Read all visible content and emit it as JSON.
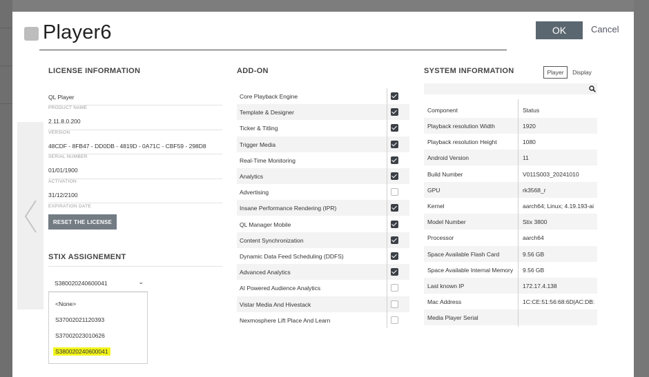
{
  "window": {
    "title": "Player6"
  },
  "header": {
    "ok_label": "OK",
    "cancel_label": "Cancel"
  },
  "license": {
    "title": "LICENSE INFORMATION",
    "fields": [
      {
        "value": "QL Player",
        "label": "PRODUCT NAME"
      },
      {
        "value": "2.11.8.0.200",
        "label": "VERSION"
      },
      {
        "value": "48CDF - 8FB47 - DD0DB - 4819D - 0A71C - CBF59 - 298D8",
        "label": "SERIAL NUMBER"
      },
      {
        "value": "01/01/1900",
        "label": "ACTIVATION"
      },
      {
        "value": "31/12/2100",
        "label": "EXPIRATION DATE"
      }
    ],
    "reset_label": "RESET THE LICENSE"
  },
  "stix": {
    "title": "STIX ASSIGNEMENT",
    "selected": "S380020240600041",
    "options": [
      "<None>",
      "S37002021120393",
      "S37002023010626",
      "S380020240600041"
    ],
    "highlighted_index": 3
  },
  "addon": {
    "title": "ADD-ON",
    "items": [
      {
        "label": "Core Playback Engine",
        "checked": true
      },
      {
        "label": "Template & Designer",
        "checked": true
      },
      {
        "label": "Ticker & Titling",
        "checked": true
      },
      {
        "label": "Trigger Media",
        "checked": true
      },
      {
        "label": "Real-Time Monitoring",
        "checked": true
      },
      {
        "label": "Analytics",
        "checked": true
      },
      {
        "label": "Advertising",
        "checked": false
      },
      {
        "label": "Insane Performance Rendering (IPR)",
        "checked": true
      },
      {
        "label": "QL Manager Mobile",
        "checked": true
      },
      {
        "label": "Content Synchronization",
        "checked": true
      },
      {
        "label": "Dynamic Data Feed Scheduling (DDFS)",
        "checked": true
      },
      {
        "label": "Advanced Analytics",
        "checked": true
      },
      {
        "label": "AI Powered Audience Analytics",
        "checked": false
      },
      {
        "label": "Vistar Media And Hivestack",
        "checked": false
      },
      {
        "label": "Nexmosphere Lift Place And Learn",
        "checked": false
      }
    ]
  },
  "system": {
    "title": "SYSTEM INFORMATION",
    "tabs": [
      "Player",
      "Display"
    ],
    "search_placeholder": "",
    "header": {
      "key": "Component",
      "value": "Status"
    },
    "rows": [
      {
        "key": "Playback resolution Width",
        "value": "1920"
      },
      {
        "key": "Playback resolution Height",
        "value": "1080"
      },
      {
        "key": "Android Version",
        "value": "11"
      },
      {
        "key": "Build Number",
        "value": "V011S003_20241010"
      },
      {
        "key": "GPU",
        "value": "rk3568_r"
      },
      {
        "key": "Kernel",
        "value": "aarch64; Linux; 4.19.193-ai"
      },
      {
        "key": "Model Number",
        "value": "Stix 3800"
      },
      {
        "key": "Processor",
        "value": "aarch64"
      },
      {
        "key": "Space Available Flash Card",
        "value": "9.56 GB"
      },
      {
        "key": "Space Available Internal Memory",
        "value": "9.56 GB"
      },
      {
        "key": "Last known IP",
        "value": "172.17.4.138"
      },
      {
        "key": "Mac Address",
        "value": "1C:CE:51:56:68:6D|AC:DB:"
      },
      {
        "key": "Media Player Serial",
        "value": ""
      }
    ]
  },
  "colors": {
    "primary_button": "#5b6770",
    "highlight": "#f2f51b",
    "checkbox_on": "#3a4046"
  },
  "icons": [
    "player-icon",
    "chevron-left-icon",
    "search-icon",
    "chevron-down-icon",
    "checkbox-icon"
  ]
}
